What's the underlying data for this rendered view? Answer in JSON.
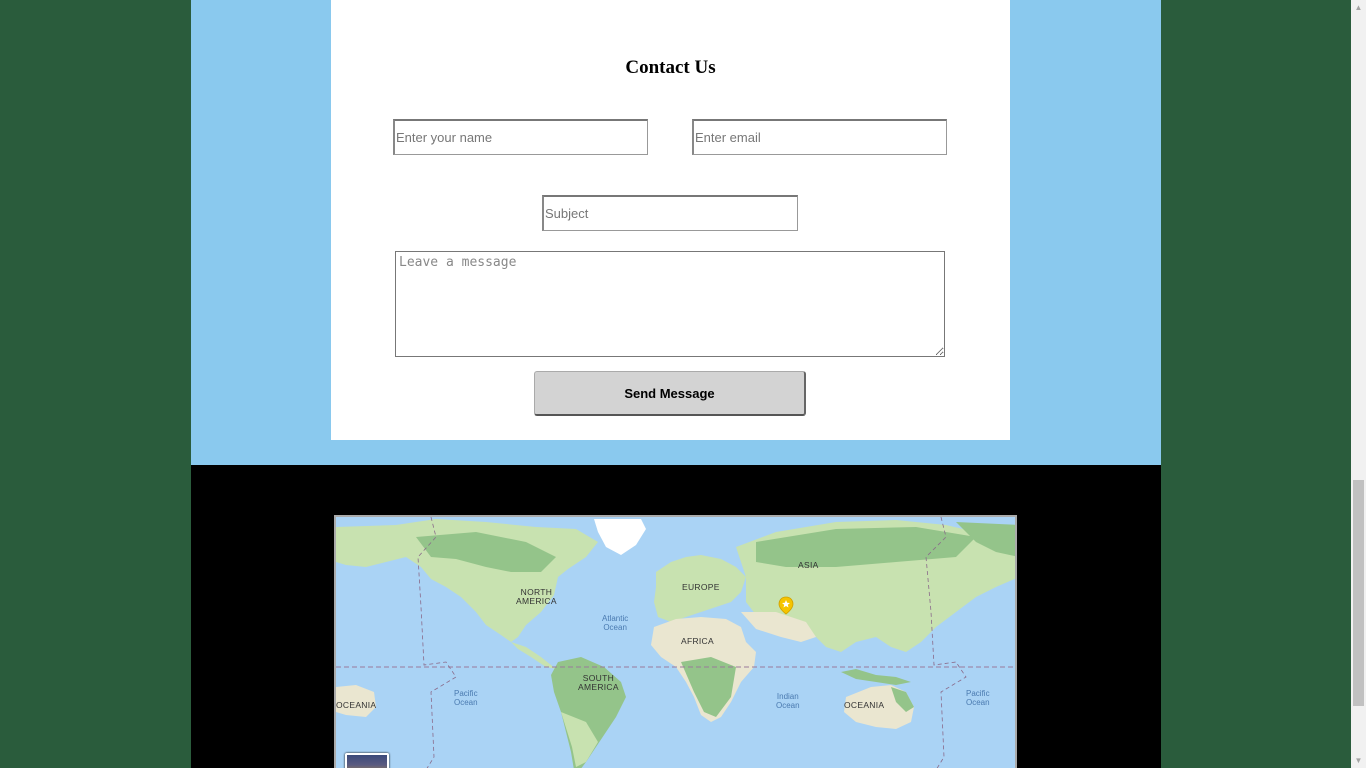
{
  "contact": {
    "title": "Contact Us",
    "name_placeholder": "Enter your name",
    "email_placeholder": "Enter email",
    "subject_placeholder": "Subject",
    "message_placeholder": "Leave a message",
    "send_label": "Send Message"
  },
  "map": {
    "labels": {
      "asia": "ASIA",
      "europe": "EUROPE",
      "north_america_1": "NORTH",
      "north_america_2": "AMERICA",
      "atlantic_1": "Atlantic",
      "atlantic_2": "Ocean",
      "africa": "AFRICA",
      "south_america_1": "SOUTH",
      "south_america_2": "AMERICA",
      "pacific_left_1": "Pacific",
      "pacific_left_2": "Ocean",
      "indian_1": "Indian",
      "indian_2": "Ocean",
      "oceania": "OCEANIA",
      "oceania_left": "OCEANIA",
      "pacific_right_1": "Pacific",
      "pacific_right_2": "Ocean"
    },
    "colors": {
      "water": "#aad3f5",
      "land": "#c8e2b0",
      "forest": "#94c48a",
      "desert": "#eae6d0",
      "ice": "#ffffff",
      "marker": "#f5c400"
    },
    "marker_icon": "star-pin-icon"
  },
  "colors": {
    "outer_bg": "#2a5c3c",
    "section_bg": "#8ac9ee",
    "card_bg": "#ffffff",
    "footer_bg": "#000000",
    "button_bg": "#d3d3d3"
  }
}
